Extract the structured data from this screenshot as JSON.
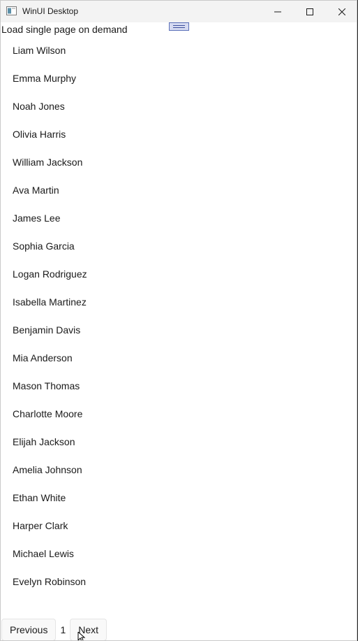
{
  "window": {
    "title": "WinUI Desktop"
  },
  "icons": {
    "app": "app-window-icon",
    "minimize": "minimize-icon",
    "maximize": "maximize-icon",
    "close": "close-icon",
    "cursor": "mouse-pointer-icon"
  },
  "heading": "Load single page on demand",
  "names": [
    "Liam Wilson",
    "Emma Murphy",
    "Noah Jones",
    "Olivia Harris",
    "William Jackson",
    "Ava Martin",
    "James Lee",
    "Sophia Garcia",
    "Logan Rodriguez",
    "Isabella Martinez",
    "Benjamin Davis",
    "Mia Anderson",
    "Mason Thomas",
    "Charlotte Moore",
    "Elijah Jackson",
    "Amelia Johnson",
    "Ethan White",
    "Harper Clark",
    "Michael Lewis",
    "Evelyn Robinson"
  ],
  "pager": {
    "previous_label": "Previous",
    "page_number": "1",
    "next_label": "Next"
  },
  "colors": {
    "titlebar": "#f3f3f3",
    "drag_handle_fill": "#d6dbf2",
    "drag_handle_border": "#5a6fb8"
  }
}
